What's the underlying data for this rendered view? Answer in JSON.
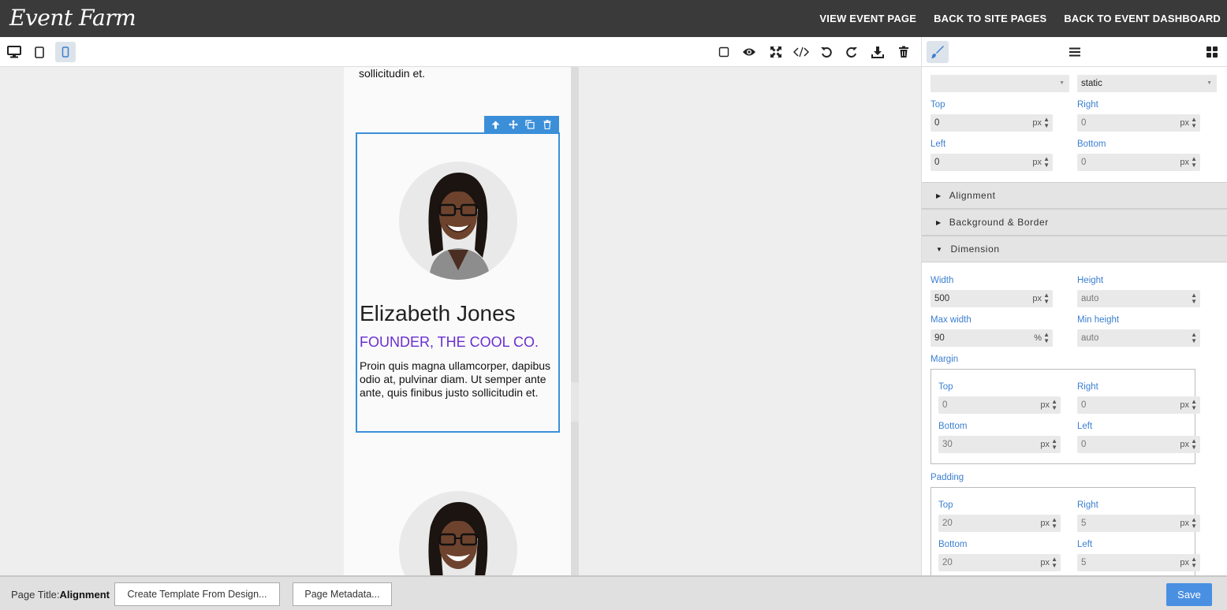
{
  "header": {
    "logo": "Event Farm",
    "nav": [
      "VIEW EVENT PAGE",
      "BACK TO SITE PAGES",
      "BACK TO EVENT DASHBOARD"
    ]
  },
  "toolbar": {
    "devices": [
      "desktop-icon",
      "tablet-icon",
      "mobile-icon"
    ],
    "active_device": "mobile",
    "tools": [
      "square-icon",
      "eye-icon",
      "fullscreen-icon",
      "code-icon",
      "undo-icon",
      "redo-icon",
      "download-icon",
      "trash-icon"
    ]
  },
  "panel_tabs": [
    "brush-icon",
    "menu-icon",
    "blocks-icon"
  ],
  "canvas": {
    "top_text": "sollicitudin et.",
    "card": {
      "name": "Elizabeth Jones",
      "title": "FOUNDER, THE COOL CO.",
      "bio": "Proin quis magna ullamcorper, dapibus odio at, pulvinar diam. Ut semper ante ante, quis finibus justo sollicitudin et."
    },
    "selection_tools": [
      "arrow-up-icon",
      "move-icon",
      "copy-icon",
      "trash-icon"
    ]
  },
  "panel": {
    "position_value": "static",
    "offsets": {
      "top_label": "Top",
      "top_value": "0",
      "right_label": "Right",
      "right_value": "0",
      "left_label": "Left",
      "left_value": "0",
      "bottom_label": "Bottom",
      "bottom_value": "0",
      "unit": "px"
    },
    "sections": {
      "alignment": "Alignment",
      "background": "Background & Border",
      "dimension": "Dimension"
    },
    "dimension": {
      "width_label": "Width",
      "width_value": "500",
      "width_unit": "px",
      "height_label": "Height",
      "height_value": "auto",
      "maxwidth_label": "Max width",
      "maxwidth_value": "90",
      "maxwidth_unit": "%",
      "minheight_label": "Min height",
      "minheight_value": "auto"
    },
    "margin": {
      "label": "Margin",
      "top_label": "Top",
      "top_value": "0",
      "right_label": "Right",
      "right_value": "0",
      "bottom_label": "Bottom",
      "bottom_value": "30",
      "left_label": "Left",
      "left_value": "0",
      "unit": "px"
    },
    "padding": {
      "label": "Padding",
      "top_label": "Top",
      "top_value": "20",
      "right_label": "Right",
      "right_value": "5",
      "bottom_label": "Bottom",
      "bottom_value": "20",
      "left_label": "Left",
      "left_value": "5",
      "unit": "px"
    }
  },
  "footer": {
    "page_title_label": "Page Title:",
    "page_title_value": "Alignment",
    "create_template": "Create Template From Design...",
    "page_metadata": "Page Metadata...",
    "save": "Save"
  },
  "colors": {
    "accent": "#3b8fd9",
    "title_purple": "#6a2fd0",
    "header_bg": "#3a3a3a",
    "save_blue": "#4a90e2"
  }
}
